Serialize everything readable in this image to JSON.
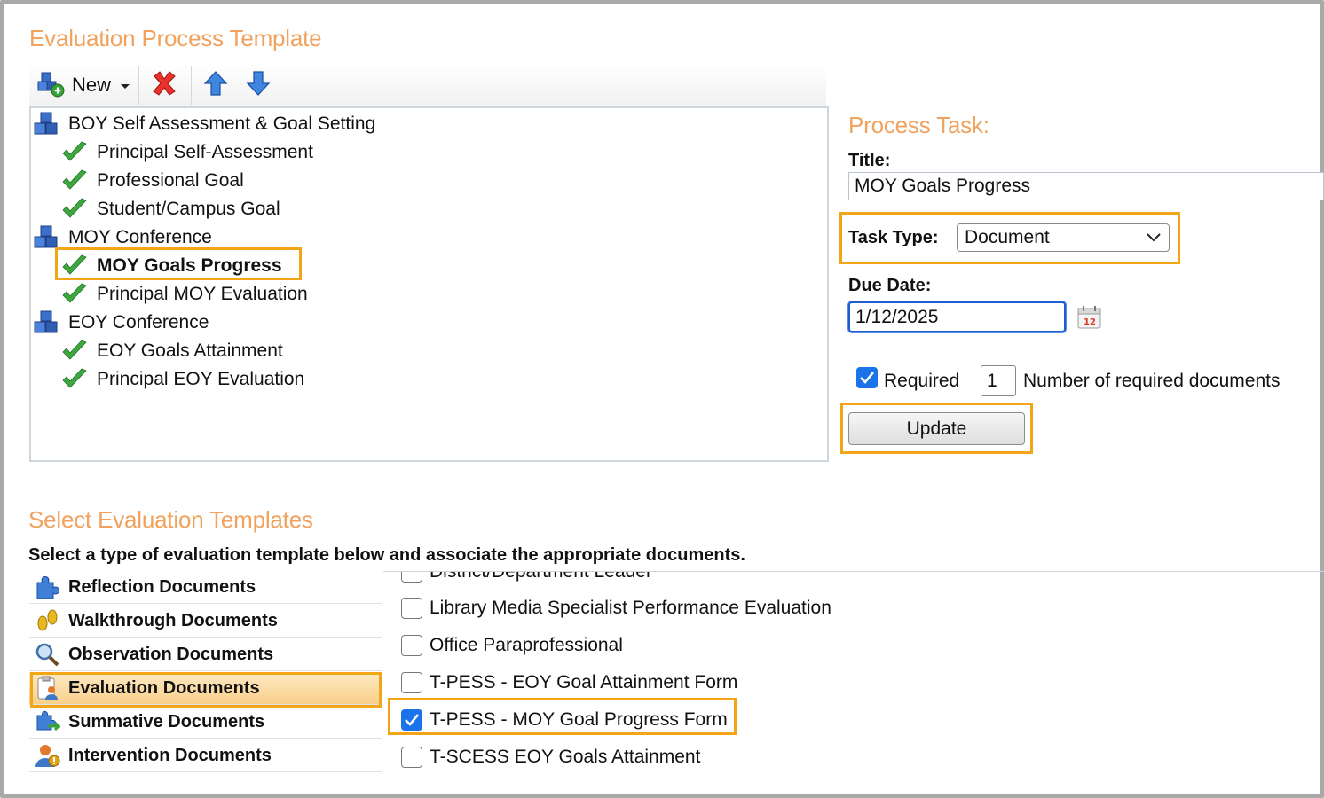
{
  "template_section": {
    "title": "Evaluation Process Template"
  },
  "toolbar": {
    "new_label": "New",
    "icons": [
      "new-icon",
      "delete-icon",
      "move-up-icon",
      "move-down-icon"
    ]
  },
  "tree": {
    "items": [
      {
        "label": "BOY Self Assessment & Goal Setting",
        "level": 0,
        "icon": "stage-icon"
      },
      {
        "label": "Principal Self-Assessment",
        "level": 1,
        "icon": "check-icon"
      },
      {
        "label": "Professional Goal",
        "level": 1,
        "icon": "check-icon"
      },
      {
        "label": "Student/Campus Goal",
        "level": 1,
        "icon": "check-icon"
      },
      {
        "label": "MOY Conference",
        "level": 0,
        "icon": "stage-icon"
      },
      {
        "label": "MOY Goals Progress",
        "level": 1,
        "icon": "check-icon",
        "selected": true
      },
      {
        "label": "Principal MOY Evaluation",
        "level": 1,
        "icon": "check-icon"
      },
      {
        "label": "EOY Conference",
        "level": 0,
        "icon": "stage-icon"
      },
      {
        "label": "EOY Goals Attainment",
        "level": 1,
        "icon": "check-icon"
      },
      {
        "label": "Principal EOY Evaluation",
        "level": 1,
        "icon": "check-icon"
      }
    ]
  },
  "process_task": {
    "heading": "Process Task:",
    "title_label": "Title:",
    "title_value": "MOY Goals Progress",
    "task_type_label": "Task Type:",
    "task_type_value": "Document",
    "due_date_label": "Due Date:",
    "due_date_value": "1/12/2025",
    "required_label": "Required",
    "required_checked": true,
    "required_count": "1",
    "required_count_label": "Number of required documents",
    "update_label": "Update"
  },
  "templates_section": {
    "title": "Select Evaluation Templates",
    "instruction": "Select a type of evaluation template below and associate the appropriate documents.",
    "categories": [
      {
        "label": "Reflection Documents",
        "icon": "puzzle-icon"
      },
      {
        "label": "Walkthrough Documents",
        "icon": "footprints-icon"
      },
      {
        "label": "Observation Documents",
        "icon": "magnifier-icon"
      },
      {
        "label": "Evaluation Documents",
        "icon": "clipboard-user-icon",
        "selected": true
      },
      {
        "label": "Summative Documents",
        "icon": "puzzle-arrows-icon"
      },
      {
        "label": "Intervention Documents",
        "icon": "user-alert-icon"
      }
    ],
    "documents": [
      {
        "label": "District/Department Leader",
        "checked": false
      },
      {
        "label": "Library Media Specialist Performance Evaluation",
        "checked": false
      },
      {
        "label": "Office Paraprofessional",
        "checked": false
      },
      {
        "label": "T-PESS - EOY Goal Attainment Form",
        "checked": false
      },
      {
        "label": "T-PESS - MOY Goal Progress Form",
        "checked": true
      },
      {
        "label": "T-SCESS EOY Goals Attainment",
        "checked": false
      }
    ]
  },
  "colors": {
    "accent_title": "#f0a25e",
    "highlight_border": "#f2a516",
    "checkbox_on": "#1a73e8"
  }
}
